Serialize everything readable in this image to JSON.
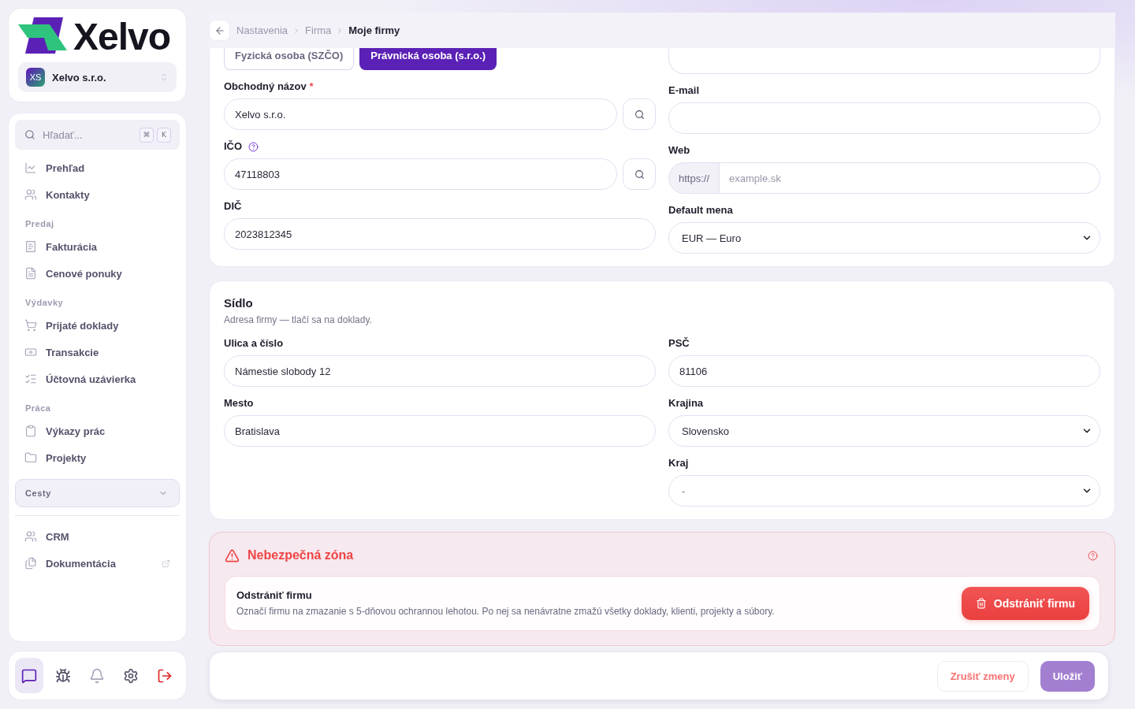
{
  "sidebar": {
    "logo": {
      "text": "Xelvo"
    },
    "company_switcher": {
      "initials": "XS",
      "name": "Xelvo s.r.o."
    },
    "search": {
      "placeholder": "Hľadať...",
      "keys": [
        "⌘",
        "K"
      ]
    },
    "nav": [
      {
        "label": "Prehľad",
        "selected": false
      },
      {
        "label": "Kontakty",
        "selected": false
      }
    ],
    "sections": [
      {
        "title": "Predaj",
        "items": [
          {
            "label": "Fakturácia",
            "selected": false
          },
          {
            "label": "Cenové ponuky",
            "selected": false
          }
        ]
      },
      {
        "title": "Výdavky",
        "items": [
          {
            "label": "Prijaté doklady",
            "selected": false
          },
          {
            "label": "Transakcie",
            "selected": false
          },
          {
            "label": "Účtovná uzávierka",
            "selected": false
          }
        ]
      },
      {
        "title": "Práca",
        "items": [
          {
            "label": "Výkazy prác",
            "selected": false
          },
          {
            "label": "Projekty",
            "selected": false
          }
        ]
      }
    ],
    "group_dropdown": {
      "label": "Cesty",
      "expanded": false
    },
    "links": [
      {
        "label": "CRM",
        "selected": false,
        "external": false
      },
      {
        "label": "Dokumentácia",
        "selected": false,
        "external": true
      }
    ],
    "toolbar": [
      {
        "selected": true
      },
      {
        "selected": false
      },
      {
        "selected": false
      },
      {
        "selected": false
      },
      {
        "selected": false
      }
    ]
  },
  "breadcrumb": [
    {
      "label": "Nastavenia",
      "current": false
    },
    {
      "label": "Firma",
      "current": false
    },
    {
      "label": "Moje firmy",
      "current": true
    }
  ],
  "company_card": {
    "entity_types": [
      {
        "label": "Fyzická osoba (SZČO)",
        "selected": false
      },
      {
        "label": "Právnická osoba (s.r.o.)",
        "selected": true
      }
    ],
    "left_fields": [
      {
        "kind": "lookup",
        "label": "Obchodný názov",
        "required_mark": "*",
        "help": false,
        "value": "Xelvo s.r.o."
      },
      {
        "kind": "lookup",
        "label": "IČO",
        "help": true,
        "value": "47118803"
      },
      {
        "kind": "text",
        "label": "DIČ",
        "help": false,
        "value": "2023812345"
      }
    ],
    "right_fields": [
      {
        "kind": "text"
      },
      {
        "kind": "text",
        "label": "E-mail"
      },
      {
        "kind": "url",
        "label": "Web",
        "prefix": "https://",
        "placeholder": "example.sk"
      },
      {
        "kind": "select",
        "label": "Default mena",
        "value": "EUR — Euro"
      }
    ]
  },
  "address_card": {
    "title": "Sídlo",
    "subtitle": "Adresa firmy — tlačí sa na doklady.",
    "left_fields": [
      {
        "kind": "text",
        "label": "Ulica a číslo",
        "value": "Námestie slobody 12"
      },
      {
        "kind": "text",
        "label": "Mesto",
        "value": "Bratislava"
      }
    ],
    "right_fields": [
      {
        "kind": "text",
        "label": "PSČ",
        "value": "81106"
      },
      {
        "kind": "select",
        "label": "Krajina",
        "value": "Slovensko"
      },
      {
        "kind": "select",
        "label": "Kraj",
        "placeholder": "-"
      }
    ]
  },
  "danger_zone": {
    "title": "Nebezpečná zóna",
    "action": {
      "title": "Odstrániť firmu",
      "description": "Označí firmu na zmazanie s 5-dňovou ochrannou lehotou. Po nej sa nenávratne zmažú všetky doklady, klienti, projekty a súbory.",
      "button": "Odstrániť firmu"
    }
  },
  "footer": {
    "cancel": {
      "label": "Zrušiť zmeny"
    },
    "save": {
      "label": "Uložiť",
      "disabled": true
    }
  }
}
